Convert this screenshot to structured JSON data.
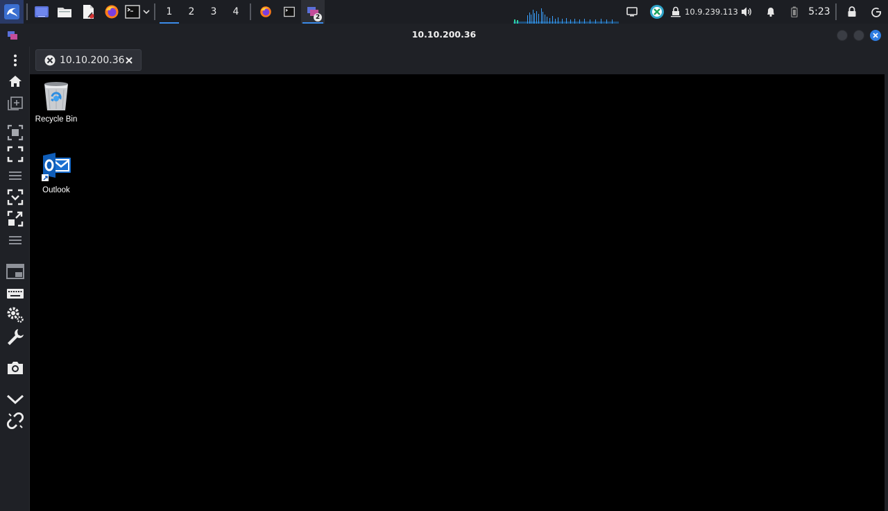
{
  "taskbar": {
    "workspaces": [
      "1",
      "2",
      "3",
      "4"
    ],
    "active_workspace": "1",
    "network_badge_count": "2",
    "vpn_ip": "10.9.239.113",
    "clock": "5:23",
    "icons": {
      "menu": "kali-dragon-icon",
      "show_desktop": "desktop-icon",
      "files": "folder-icon",
      "editor": "text-editor-icon",
      "browser": "firefox-icon",
      "terminal": "terminal-icon",
      "dropdown": "chevron-down-icon"
    },
    "accent_color": "#3b8be9"
  },
  "window": {
    "title": "10.10.200.36",
    "close_color": "#2f7de1"
  },
  "tab": {
    "label": "10.10.200.36"
  },
  "sidebar": {
    "tools": [
      "menu",
      "home",
      "new-tab",
      "select-area",
      "fullscreen",
      "divider",
      "fit-window",
      "resize-remote",
      "divider",
      "picture-in-picture",
      "keyboard",
      "preferences",
      "tools",
      "screenshot",
      "collapse",
      "disconnect"
    ]
  },
  "desktop": {
    "icons": [
      {
        "label": "Recycle Bin",
        "icon": "recycle-bin-icon"
      },
      {
        "label": "Outlook",
        "icon": "outlook-icon"
      }
    ]
  }
}
